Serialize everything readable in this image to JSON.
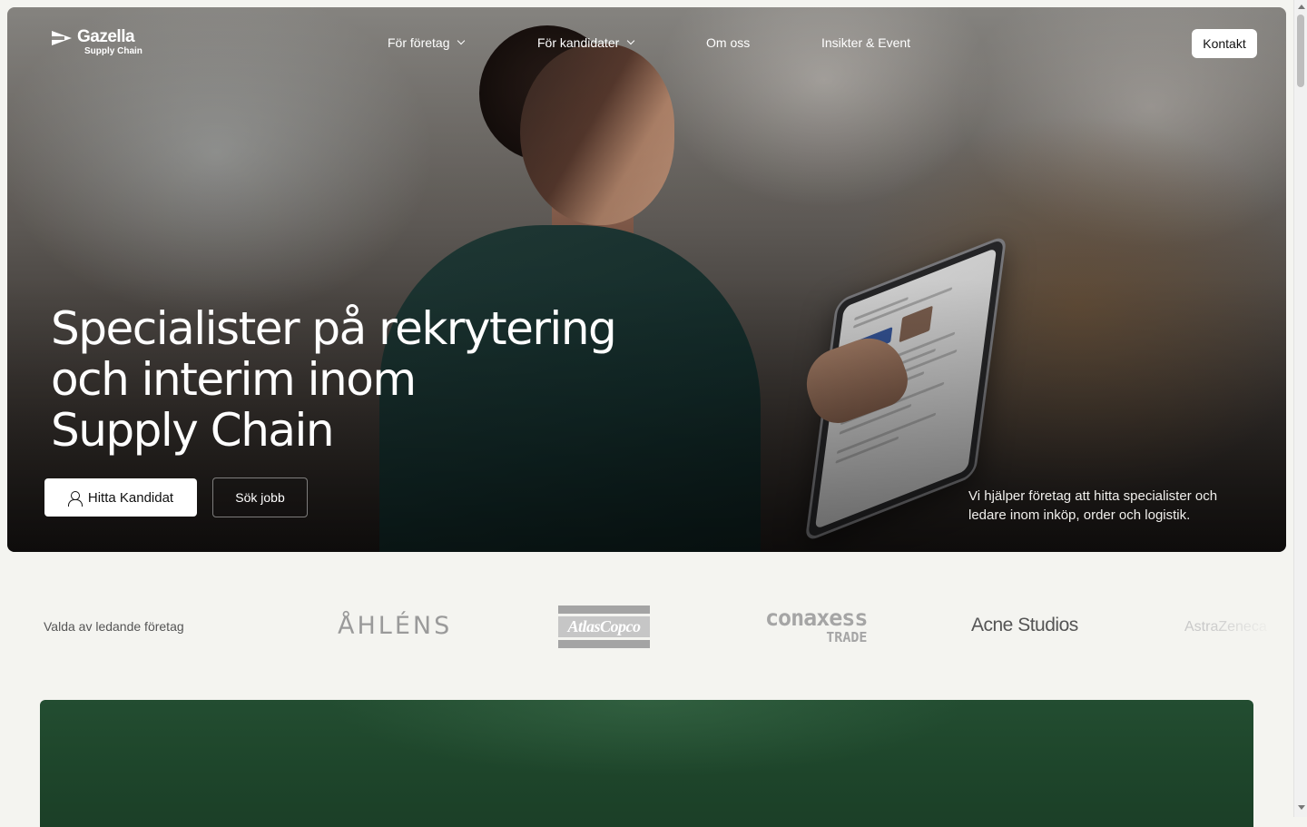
{
  "brand": {
    "name": "Gazella",
    "sub": "Supply Chain",
    "logo_icon": "gazelle-arrow-logo"
  },
  "nav": {
    "items": [
      {
        "label": "För företag",
        "has_dropdown": true
      },
      {
        "label": "För kandidater",
        "has_dropdown": true
      },
      {
        "label": "Om oss",
        "has_dropdown": false
      },
      {
        "label": "Insikter & Event",
        "has_dropdown": false
      }
    ],
    "contact_label": "Kontakt"
  },
  "hero": {
    "headline_lines": [
      "Specialister på rekrytering",
      "och interim inom",
      "Supply Chain"
    ],
    "primary_cta": "Hitta Kandidat",
    "primary_cta_icon": "person-icon",
    "secondary_cta": "Sök jobb",
    "description": "Vi hjälper företag att hitta specialister och ledare inom inköp, order och logistik."
  },
  "clients": {
    "label": "Valda av ledande företag",
    "logos": [
      {
        "name": "ÅHLÉNS"
      },
      {
        "name": "AtlasCopco"
      },
      {
        "name": "conaxess",
        "sub": "TRADE"
      },
      {
        "name": "Acne Studios"
      },
      {
        "name": "AstraZeneca"
      }
    ]
  },
  "colors": {
    "page_bg": "#f4f4f0",
    "green_section": "#1f472c",
    "button_bg": "#ffffff",
    "hero_text": "#ffffff"
  }
}
